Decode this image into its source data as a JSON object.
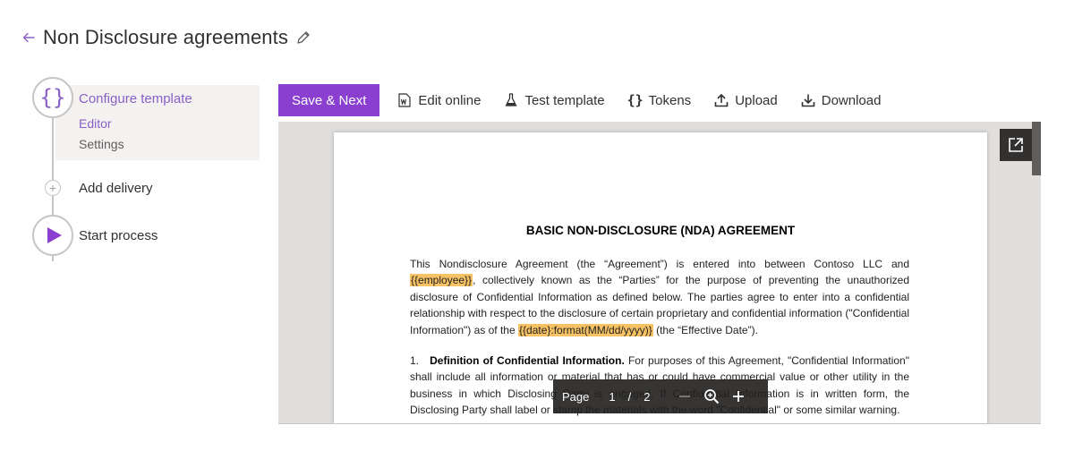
{
  "header": {
    "title": "Non Disclosure agreements"
  },
  "steps": {
    "configure": {
      "label": "Configure template",
      "icon": "braces-icon"
    },
    "sub_items": [
      "Editor",
      "Settings"
    ],
    "add_delivery": {
      "label": "Add delivery"
    },
    "start_process": {
      "label": "Start process"
    }
  },
  "toolbar": {
    "save_next": "Save & Next",
    "edit_online": "Edit online",
    "test_template": "Test template",
    "tokens": "Tokens",
    "upload": "Upload",
    "download": "Download"
  },
  "document": {
    "title": "BASIC NON-DISCLOSURE (NDA) AGREEMENT",
    "p1_a": "This Nondisclosure Agreement (the “Agreement”) is entered into between Contoso LLC and",
    "token_employee": "{{employee}}",
    "p1_b": ", collectively known as the “Parties” for the purpose of preventing the unauthorized disclosure of Confidential Information as defined below. The parties agree to enter into a confidential relationship with respect to the disclosure of certain proprietary and confidential information (\"Confidential Information\") as of the",
    "token_date": "{{date}:format(MM/dd/yyyy)}",
    "p1_c": "(the “Effective Date”).",
    "p2_num": "1.",
    "p2_heading": "Definition of Confidential Information.",
    "p2_text": "For purposes of this Agreement, \"Confidential Information\" shall include all information or material that has or could have commercial value or other utility in the business in which Disclosing Party is engaged. If Confidential Information is in written form, the Disclosing Party shall label or stamp the materials with the word \"Confidential\" or some similar warning."
  },
  "pager": {
    "label": "Page",
    "current": "1",
    "separator": "/",
    "total": "2"
  },
  "colors": {
    "accent": "#8a3fd1",
    "accent_text": "#8a60c7",
    "token_highlight": "#f7c264",
    "viewer_bg": "#e1dfdd"
  }
}
